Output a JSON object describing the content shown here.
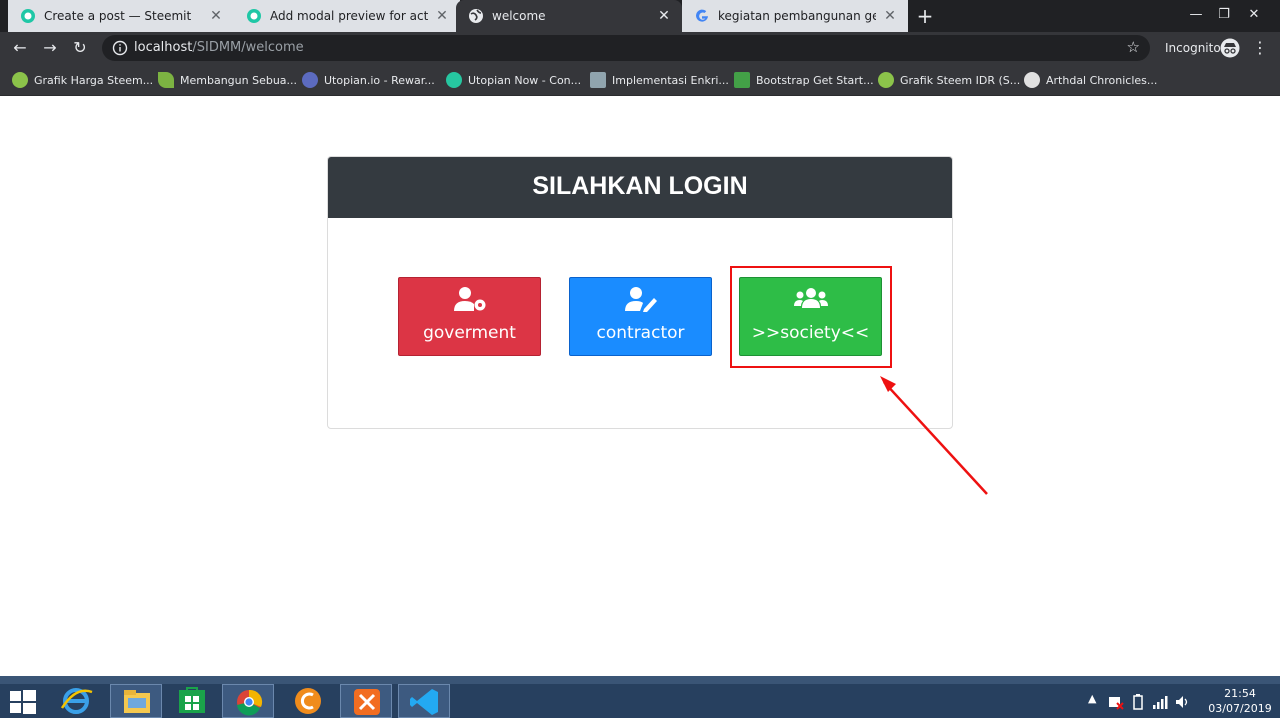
{
  "browser": {
    "tabs": [
      {
        "title": "Create a post — Steemit",
        "favicon": "steemit-icon"
      },
      {
        "title": "Add modal preview for activity Re",
        "favicon": "steemit-icon"
      },
      {
        "title": "welcome",
        "favicon": "globe-icon",
        "active": true
      },
      {
        "title": "kegiatan pembangunan gedung",
        "favicon": "google-icon"
      }
    ],
    "new_tab_label": "+",
    "address": {
      "host": "localhost",
      "path": "/SIDMM/welcome"
    },
    "incognito_label": "Incognito"
  },
  "bookmarks": [
    {
      "label": "Grafik Harga Steem...",
      "icon_color": "#8bc34a"
    },
    {
      "label": "Membangun Sebua...",
      "icon_color": "#7cb342"
    },
    {
      "label": "Utopian.io - Rewar...",
      "icon_color": "#5c6bc0"
    },
    {
      "label": "Utopian Now - Con...",
      "icon_color": "#26c6a0"
    },
    {
      "label": "Implementasi Enkri...",
      "icon_color": "#90a4ae"
    },
    {
      "label": "Bootstrap Get Start...",
      "icon_color": "#43a047"
    },
    {
      "label": "Grafik Steem IDR (S...",
      "icon_color": "#8bc34a"
    },
    {
      "label": "Arthdal Chronicles...",
      "icon_color": "#e0e0e0"
    }
  ],
  "login": {
    "title": "SILAHKAN LOGIN",
    "buttons": [
      {
        "label": "goverment",
        "icon": "user-cog-icon",
        "color": "#dc3545"
      },
      {
        "label": "contractor",
        "icon": "user-edit-icon",
        "color": "#1a8cff"
      },
      {
        "label": ">>society<<",
        "icon": "users-icon",
        "color": "#2ebd47"
      }
    ]
  },
  "taskbar": {
    "clock_time": "21:54",
    "clock_date": "03/07/2019"
  }
}
